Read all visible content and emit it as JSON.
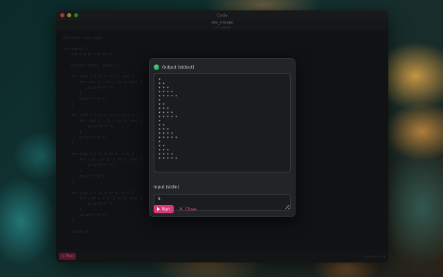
{
  "window": {
    "app_title": "Code",
    "file_name": "star_triangle",
    "file_sub": "c++ source"
  },
  "editor": {
    "code": "#include <iostream>\n\nint main() {\n    int n = 0; cin >> n;\n\n    printf(\"%d\\n\", result);\n\n    for (int i = 1; i <= n; i++) {\n        for (int j = 1; j <= i; j++) {\n            printf(\"* \");\n        }\n        printf(\"\\n\");\n    }\n\n    for (int i = 1; i <= n; i++) {\n        for (int j = 1; j <= i; j++) {\n            printf(\"* \");\n        }\n        printf(\"\\n\");\n    }\n\n    for (int i = 1; i <= n; i++) {\n        for (int j = 1; j <= i; j++) {\n            printf(\"* \");\n        }\n        printf(\"\\n\");\n    }\n\n    for (int i = 1; i <= n; i++) {\n        for (int j = 1; j <= i; j++) {\n            printf(\"* \");\n        }\n        printf(\"\\n\");\n    }\n\n    return 0;\n}"
  },
  "footer": {
    "run_label": "Run",
    "status": "Compiled · C++"
  },
  "dialog": {
    "output_label": "Output (stdout)",
    "output_text": "*\n* *\n* * *\n* * * *\n* * * * *\n*\n* *\n* * *\n* * * *\n* * * * *\n*\n* *\n* * *\n* * * *\n* * * * *\n*\n* *\n* * *\n* * * *\n* * * * *",
    "input_label": "Input (stdin)",
    "input_value": "5",
    "run_label": "Run",
    "close_label": "Close"
  }
}
